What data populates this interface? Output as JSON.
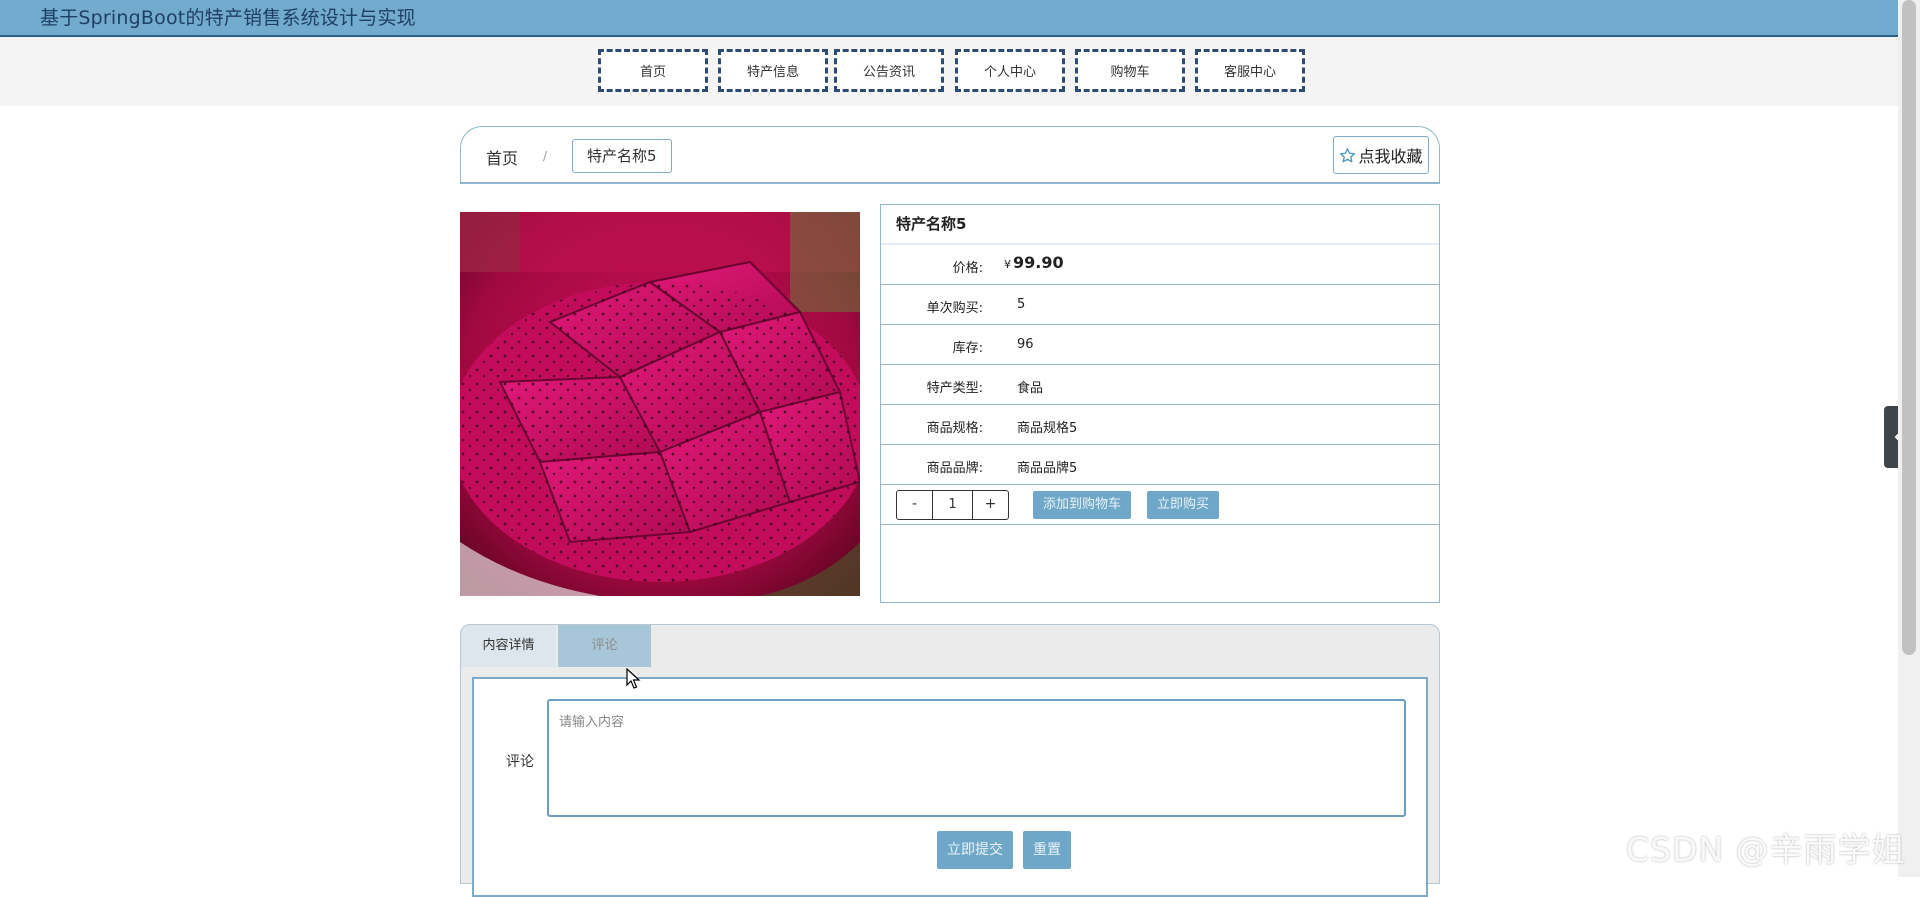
{
  "header": {
    "title": "基于SpringBoot的特产销售系统设计与实现"
  },
  "nav": {
    "items": [
      "首页",
      "特产信息",
      "公告资讯",
      "个人中心",
      "购物车",
      "客服中心"
    ]
  },
  "breadcrumb": {
    "home": "首页",
    "separator": "/",
    "current": "特产名称5",
    "favorite_label": "点我收藏"
  },
  "product": {
    "name": "特产名称5",
    "price_symbol": "¥",
    "price": "99.90",
    "fields": [
      {
        "label": "单次购买:",
        "value": "5"
      },
      {
        "label": "库存:",
        "value": "96"
      },
      {
        "label": "特产类型:",
        "value": "食品"
      },
      {
        "label": "商品规格:",
        "value": "商品规格5"
      },
      {
        "label": "商品品牌:",
        "value": "商品品牌5"
      }
    ],
    "price_label": "价格:",
    "quantity": {
      "minus": "-",
      "value": "1",
      "plus": "+"
    },
    "add_to_cart": "添加到购物车",
    "buy_now": "立即购买"
  },
  "tabs": {
    "detail": "内容详情",
    "comment": "评论"
  },
  "comment_form": {
    "label": "评论",
    "placeholder": "请输入内容",
    "submit": "立即提交",
    "reset": "重置"
  },
  "watermark": "CSDN @辛雨学姐",
  "colors": {
    "header_bg": "#72abcd",
    "accent": "#6fa7c8",
    "nav_border": "#2d4b78"
  }
}
